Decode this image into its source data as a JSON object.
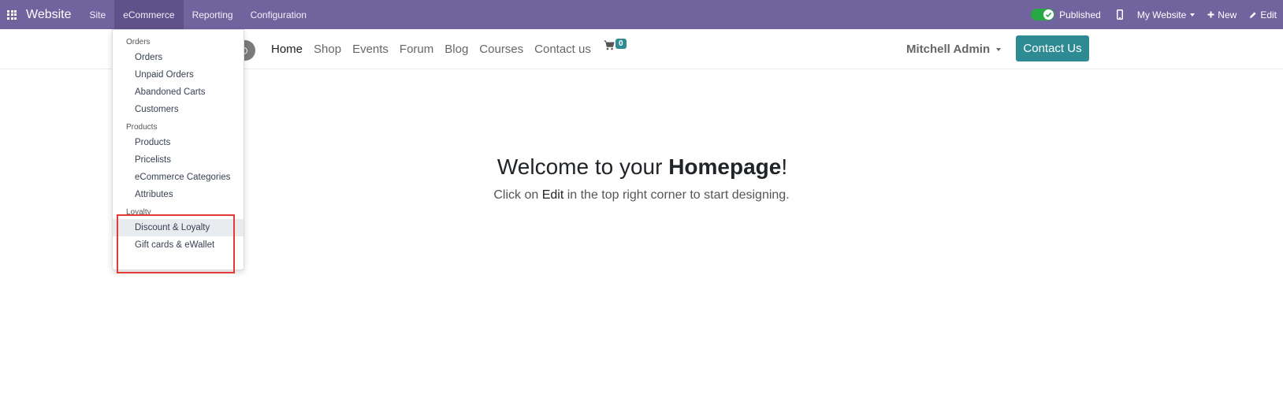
{
  "topbar": {
    "brand": "Website",
    "menu": [
      "Site",
      "eCommerce",
      "Reporting",
      "Configuration"
    ],
    "active_menu": "eCommerce",
    "published_label": "Published",
    "my_website_label": "My Website",
    "new_label": "New",
    "edit_label": "Edit",
    "accent_color": "#71639e"
  },
  "site_header": {
    "nav": [
      "Home",
      "Shop",
      "Events",
      "Forum",
      "Blog",
      "Courses",
      "Contact us"
    ],
    "current_nav": "Home",
    "cart_count": "0",
    "user_name": "Mitchell Admin",
    "contact_button": "Contact Us",
    "button_color": "#2e8b94"
  },
  "hero": {
    "title_prefix": "Welcome to your ",
    "title_bold": "Homepage",
    "title_suffix": "!",
    "sub_prefix": "Click on ",
    "sub_bold": "Edit",
    "sub_suffix": " in the top right corner to start designing."
  },
  "dropdown": {
    "sections": [
      {
        "header": "Orders",
        "items": [
          "Orders",
          "Unpaid Orders",
          "Abandoned Carts",
          "Customers"
        ]
      },
      {
        "header": "Products",
        "items": [
          "Products",
          "Pricelists",
          "eCommerce Categories",
          "Attributes"
        ]
      },
      {
        "header": "Loyalty",
        "items": [
          "Discount & Loyalty",
          "Gift cards & eWallet"
        ]
      }
    ],
    "hovered_item": "Discount & Loyalty",
    "highlight_color": "#e53935"
  }
}
